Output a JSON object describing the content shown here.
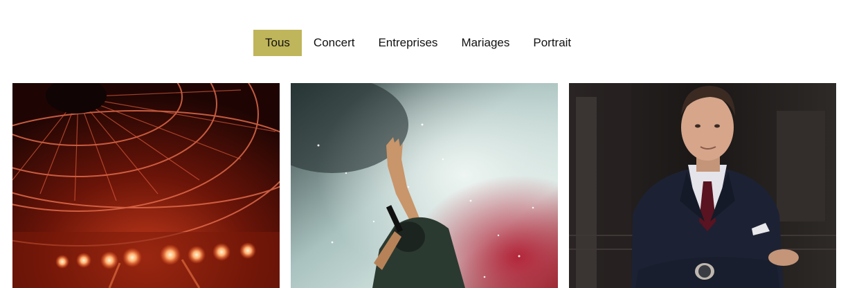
{
  "filters": {
    "items": [
      {
        "label": "Tous",
        "active": true
      },
      {
        "label": "Concert",
        "active": false
      },
      {
        "label": "Entreprises",
        "active": false
      },
      {
        "label": "Mariages",
        "active": false
      },
      {
        "label": "Portrait",
        "active": false
      }
    ],
    "active_color": "#bfb55a"
  },
  "gallery": {
    "images": [
      {
        "subject": "concert-stage-lights-image"
      },
      {
        "subject": "performer-raising-hand-smoke-image"
      },
      {
        "subject": "man-in-suit-portrait-image"
      }
    ]
  }
}
